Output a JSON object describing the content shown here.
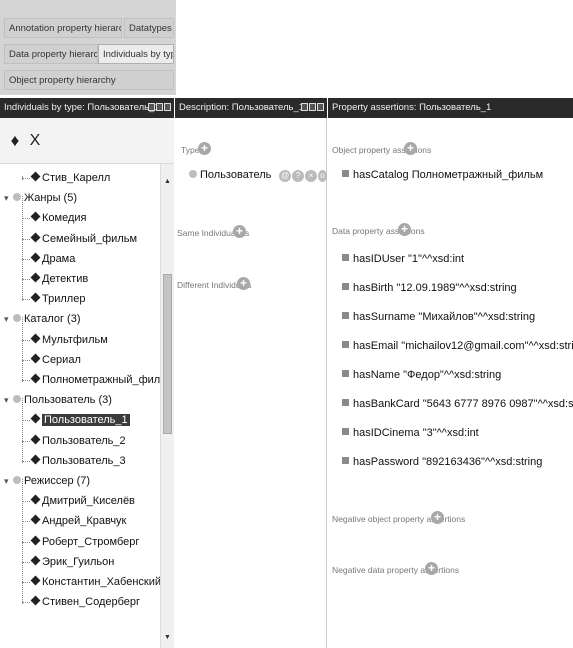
{
  "tabs": [
    {
      "label": "Annotation property hierarchy",
      "active": false
    },
    {
      "label": "Datatypes",
      "active": false
    },
    {
      "label": "Data property hierarchy",
      "active": false
    },
    {
      "label": "Individuals by type",
      "active": true
    },
    {
      "label": "Object property hierarchy",
      "active": false
    }
  ],
  "headers": {
    "left": "Individuals by type: Пользователь_1",
    "middle": "Description: Пользователь_1",
    "right": "Property assertions: Пользователь_1"
  },
  "toolbar": {
    "add_icon": "add-individual-icon",
    "delete_icon": "delete-individual-icon",
    "add_glyph": "♦",
    "delete_glyph": "X"
  },
  "tree": [
    {
      "label": "Стив_Карелл",
      "kind": "individual",
      "level": 1
    },
    {
      "label": "Жанры (5)",
      "kind": "class",
      "level": 0
    },
    {
      "label": "Комедия",
      "kind": "individual",
      "level": 1
    },
    {
      "label": "Семейный_фильм",
      "kind": "individual",
      "level": 1
    },
    {
      "label": "Драма",
      "kind": "individual",
      "level": 1
    },
    {
      "label": "Детектив",
      "kind": "individual",
      "level": 1
    },
    {
      "label": "Триллер",
      "kind": "individual",
      "level": 1
    },
    {
      "label": "Каталог (3)",
      "kind": "class",
      "level": 0
    },
    {
      "label": "Мультфильм",
      "kind": "individual",
      "level": 1
    },
    {
      "label": "Сериал",
      "kind": "individual",
      "level": 1
    },
    {
      "label": "Полнометражный_фильм",
      "kind": "individual",
      "level": 1
    },
    {
      "label": "Пользователь (3)",
      "kind": "class",
      "level": 0
    },
    {
      "label": "Пользователь_1",
      "kind": "individual",
      "level": 1,
      "selected": true
    },
    {
      "label": "Пользователь_2",
      "kind": "individual",
      "level": 1
    },
    {
      "label": "Пользователь_3",
      "kind": "individual",
      "level": 1
    },
    {
      "label": "Режиссер (7)",
      "kind": "class",
      "level": 0
    },
    {
      "label": "Дмитрий_Киселёв",
      "kind": "individual",
      "level": 1
    },
    {
      "label": "Андрей_Кравчук",
      "kind": "individual",
      "level": 1
    },
    {
      "label": "Роберт_Стромберг",
      "kind": "individual",
      "level": 1
    },
    {
      "label": "Эрик_Гуильон",
      "kind": "individual",
      "level": 1
    },
    {
      "label": "Константин_Хабенский",
      "kind": "individual",
      "level": 1
    },
    {
      "label": "Стивен_Содерберг",
      "kind": "individual",
      "level": 1
    }
  ],
  "description": {
    "types_label": "Types",
    "type_value": "Пользователь",
    "same_label": "Same Individual As",
    "different_label": "Different Individuals"
  },
  "assertions": {
    "object_label": "Object property assertions",
    "object_items": [
      "hasCatalog  Полнометражный_фильм"
    ],
    "data_label": "Data property assertions",
    "data_items": [
      "hasIDUser  \"1\"^^xsd:int",
      "hasBirth  \"12.09.1989\"^^xsd:string",
      "hasSurname  \"Михайлов\"^^xsd:string",
      "hasEmail  \"michailov12@gmail.com\"^^xsd:string",
      "hasName  \"Федор\"^^xsd:string",
      "hasBankCard  \"5643 6777 8976 0987\"^^xsd:string",
      "hasIDCinema  \"3\"^^xsd:int",
      "hasPassword  \"892163436\"^^xsd:string"
    ],
    "neg_object_label": "Negative object property assertions",
    "neg_data_label": "Negative data property assertions"
  },
  "icons": {
    "add": "add-circle-icon",
    "individual": "diamond-icon",
    "class": "class-circle-icon",
    "property": "property-square-icon"
  }
}
